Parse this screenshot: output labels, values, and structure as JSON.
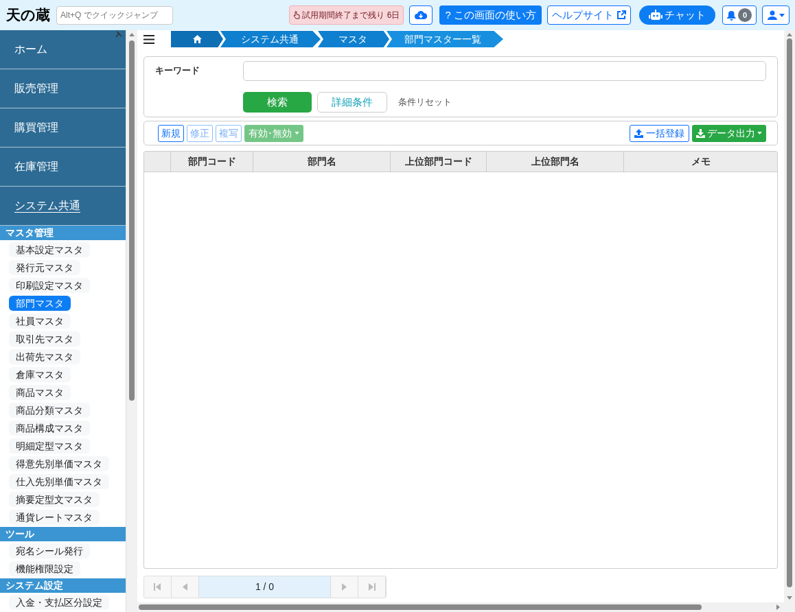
{
  "header": {
    "logo": "天の蔵",
    "quick_jump": {
      "placeholder": "Alt+Q でクイックジャンプ"
    },
    "trial_notice": "試用期間終了まで残り 6日",
    "buttons": [
      {
        "kind": "download"
      },
      {
        "kind": "howto",
        "label": "? この画面の使い方"
      },
      {
        "kind": "help",
        "label": "ヘルプサイト"
      },
      {
        "kind": "chat",
        "label": "チャット"
      }
    ],
    "notifications": {
      "count": "0"
    }
  },
  "sidebar": {
    "main_items": [
      {
        "label": "ホーム",
        "selected": false
      },
      {
        "label": "販売管理",
        "selected": false
      },
      {
        "label": "購買管理",
        "selected": false
      },
      {
        "label": "在庫管理",
        "selected": false
      },
      {
        "label": "システム共通",
        "selected": true
      }
    ],
    "sections": [
      {
        "title": "マスタ管理",
        "items": [
          {
            "label": "基本設定マスタ",
            "selected": false
          },
          {
            "label": "発行元マスタ",
            "selected": false
          },
          {
            "label": "印刷設定マスタ",
            "selected": false
          },
          {
            "label": "部門マスタ",
            "selected": true
          },
          {
            "label": "社員マスタ",
            "selected": false
          },
          {
            "label": "取引先マスタ",
            "selected": false
          },
          {
            "label": "出荷先マスタ",
            "selected": false
          },
          {
            "label": "倉庫マスタ",
            "selected": false
          },
          {
            "label": "商品マスタ",
            "selected": false
          },
          {
            "label": "商品分類マスタ",
            "selected": false
          },
          {
            "label": "商品構成マスタ",
            "selected": false
          },
          {
            "label": "明細定型マスタ",
            "selected": false
          },
          {
            "label": "得意先別単価マスタ",
            "selected": false
          },
          {
            "label": "仕入先別単価マスタ",
            "selected": false
          },
          {
            "label": "摘要定型文マスタ",
            "selected": false
          },
          {
            "label": "通貨レートマスタ",
            "selected": false
          }
        ]
      },
      {
        "title": "ツール",
        "items": [
          {
            "label": "宛名シール発行",
            "selected": false
          },
          {
            "label": "機能権限設定",
            "selected": false
          }
        ]
      },
      {
        "title": "システム設定",
        "items": [
          {
            "label": "入金・支払区分設定",
            "selected": false
          }
        ]
      }
    ]
  },
  "breadcrumb": [
    "システム共通",
    "マスタ",
    "部門マスター一覧"
  ],
  "search": {
    "keyword_label": "キーワード",
    "search_button": "検索",
    "detail_button": "詳細条件",
    "reset_link": "条件リセット"
  },
  "toolbar": {
    "left": [
      {
        "label": "新規",
        "kind": "outline",
        "disabled": false
      },
      {
        "label": "修正",
        "kind": "outline",
        "disabled": true
      },
      {
        "label": "複写",
        "kind": "outline",
        "disabled": true
      },
      {
        "label": "有効･無効",
        "kind": "dropdown",
        "disabled": true
      }
    ],
    "right": [
      {
        "label": "一括登録",
        "kind": "upload"
      },
      {
        "label": "データ出力",
        "kind": "export"
      }
    ]
  },
  "table": {
    "columns": [
      "部門コード",
      "部門名",
      "上位部門コード",
      "上位部門名",
      "メモ"
    ]
  },
  "pagination": {
    "page": "1 / 0",
    "first_disabled": true,
    "prev_disabled": true,
    "next_disabled": true,
    "last_disabled": true
  }
}
